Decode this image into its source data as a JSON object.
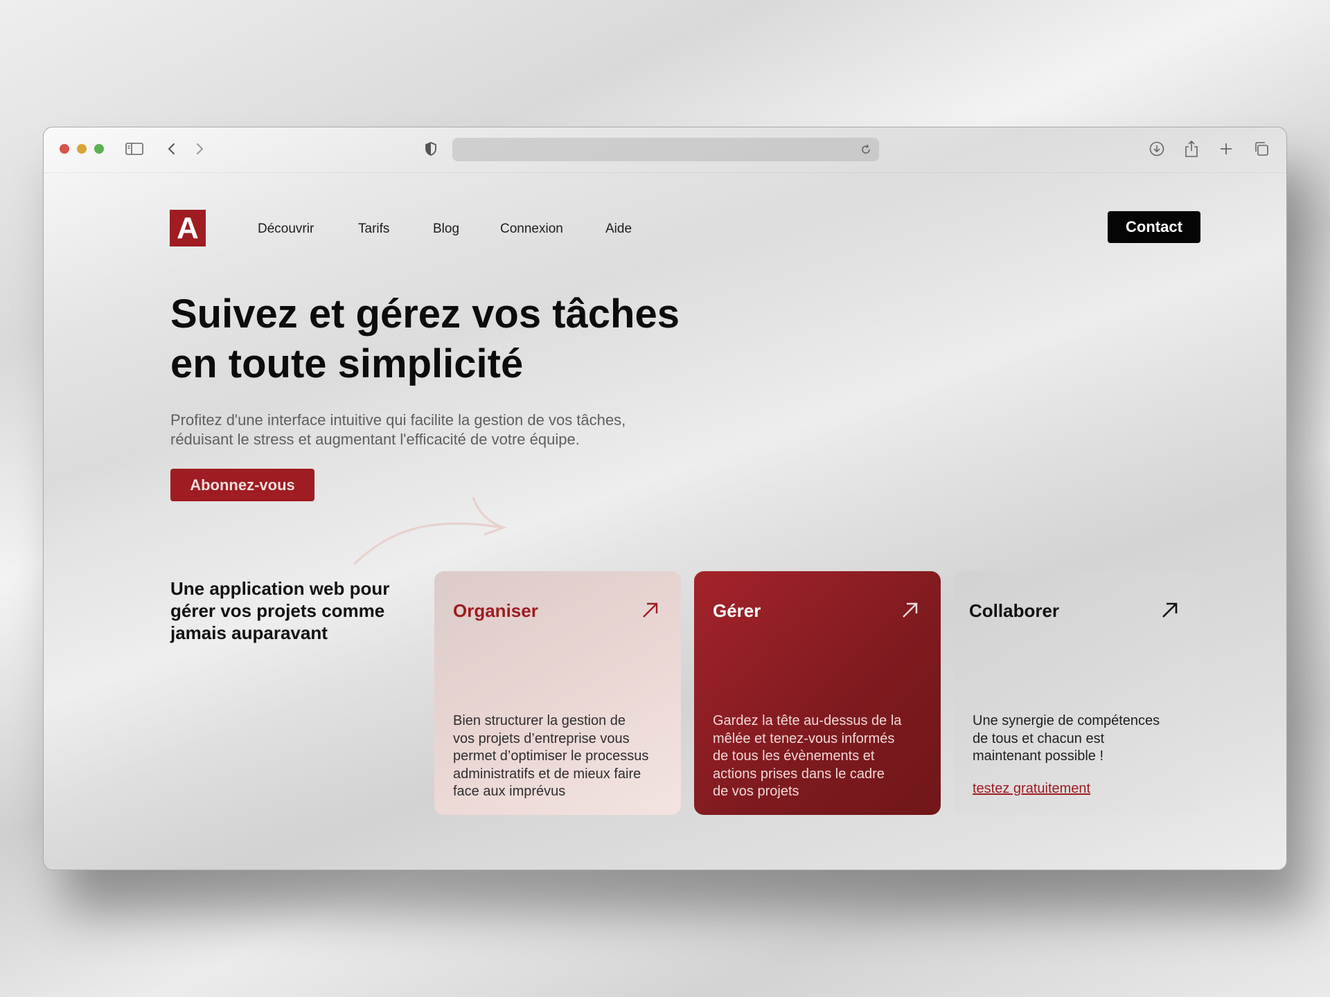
{
  "colors": {
    "brand": "#9e1c22",
    "contact_button": "#050505",
    "card_primary": "#8a1d22"
  },
  "logo": {
    "letter": "A"
  },
  "nav": {
    "items": [
      {
        "label": "Découvrir"
      },
      {
        "label": "Tarifs"
      },
      {
        "label": "Blog"
      },
      {
        "label": "Connexion"
      },
      {
        "label": "Aide"
      }
    ],
    "contact_label": "Contact"
  },
  "hero": {
    "title_line1": "Suivez et gérez vos tâches",
    "title_line2": "en toute simplicité",
    "subtitle_line1": "Profitez d'une interface intuitive qui facilite la gestion de vos tâches,",
    "subtitle_line2": "réduisant le stress et augmentant l'efficacité de votre équipe.",
    "cta_label": "Abonnez-vous"
  },
  "tagline": {
    "line1": "Une application web pour",
    "line2": "gérer vos projets comme",
    "line3": "jamais auparavant"
  },
  "cards": [
    {
      "title": "Organiser",
      "lines": [
        "Bien structurer la gestion de",
        "vos projets d’entreprise vous",
        "permet d’optimiser le processus",
        "administratifs et de mieux faire",
        "face aux imprévus"
      ]
    },
    {
      "title": "Gérer",
      "lines": [
        "Gardez la tête au-dessus de la",
        "mêlée et tenez-vous informés",
        "de tous les évènements et",
        "actions prises dans le cadre",
        "de vos projets"
      ]
    },
    {
      "title": "Collaborer",
      "lines": [
        "Une synergie de compétences",
        "de tous et chacun est",
        "maintenant possible !"
      ],
      "link": "testez gratuitement"
    }
  ]
}
